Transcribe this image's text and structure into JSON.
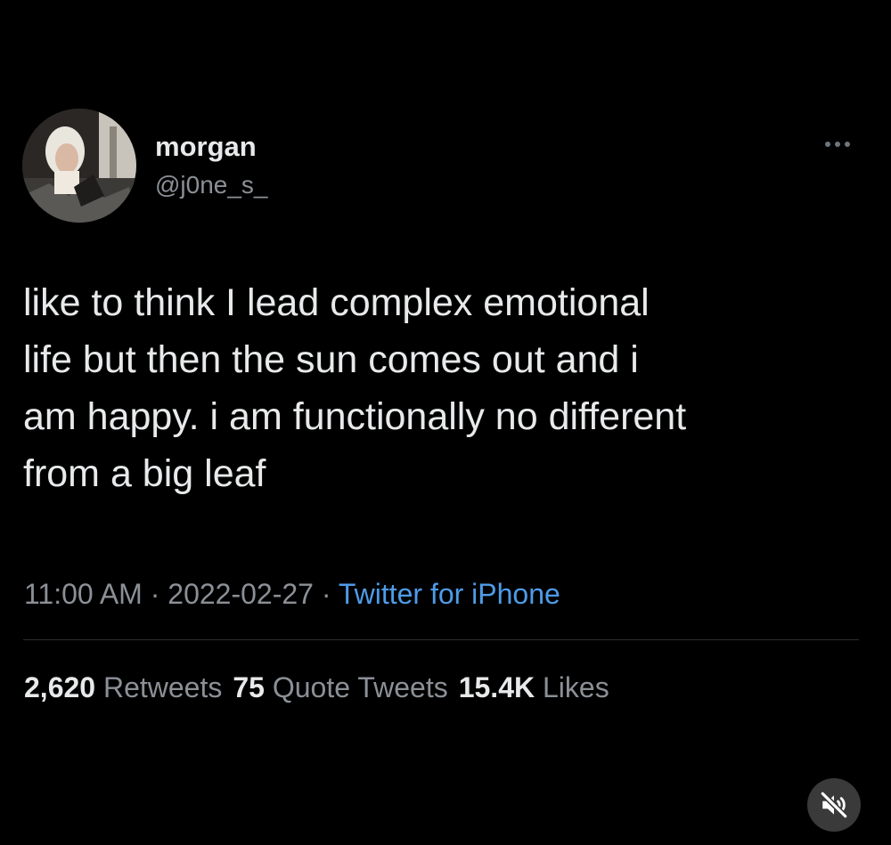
{
  "user": {
    "display_name": "morgan",
    "handle": "@j0ne_s_",
    "avatar_icon": "user-avatar-photo"
  },
  "tweet": {
    "text": "like to think I lead complex emotional\nlife but then the sun comes out and i\nam happy. i am functionally no different\nfrom a big leaf",
    "time": "11:00 AM",
    "date": "2022-02-27",
    "separator": "·",
    "source": "Twitter for iPhone"
  },
  "stats": {
    "retweets_count": "2,620",
    "retweets_label": "Retweets",
    "quotes_count": "75",
    "quotes_label": "Quote Tweets",
    "likes_count": "15.4K",
    "likes_label": "Likes"
  },
  "icons": {
    "more": "more-horizontal-icon",
    "mute": "muted-speaker-icon"
  },
  "colors": {
    "background": "#000000",
    "primary_text": "#e7e9ea",
    "secondary_text": "#8b9096",
    "link": "#4f9be8"
  }
}
